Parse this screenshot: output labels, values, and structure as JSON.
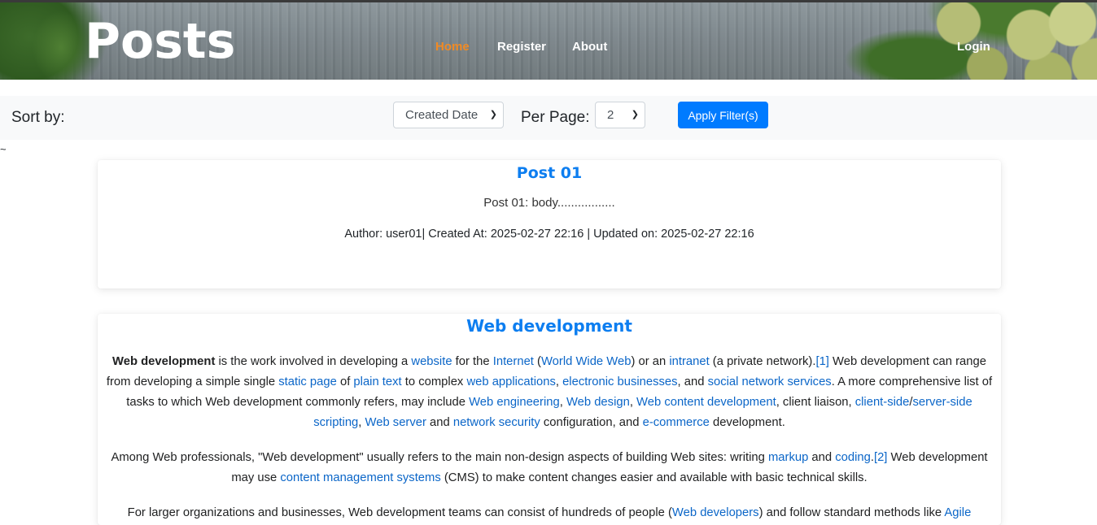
{
  "header": {
    "brand": "Posts",
    "nav": {
      "home": "Home",
      "register": "Register",
      "about": "About",
      "login": "Login"
    },
    "active_color": "#f08a24"
  },
  "filters": {
    "sort_label": "Sort by:",
    "sort_selected": "Created Date",
    "per_page_label": "Per Page:",
    "per_page_selected": "2",
    "apply_label": "Apply Filter(s)",
    "accent": "#007bff"
  },
  "stray_char": "~",
  "posts": [
    {
      "title": "Post 01",
      "body": "Post 01: body.................",
      "meta": "Author: user01| Created At: 2025-02-27 22:16 | Updated on: 2025-02-27 22:16"
    },
    {
      "title": "Web development",
      "p1": {
        "a": "Web development",
        "b": " is the work involved in developing a ",
        "c": "website",
        "d": " for the ",
        "e": "Internet",
        "f": " (",
        "g": "World Wide Web",
        "h": ") or an ",
        "i": "intranet",
        "j": " (a private network).",
        "k": "[1]",
        "l": " Web development can range from developing a simple single ",
        "m": "static page",
        "n": " of ",
        "o": "plain text",
        "p": " to complex ",
        "q": "web applications",
        "r": ", ",
        "s": "electronic businesses",
        "t": ", and ",
        "u": "social network services",
        "v": ". A more comprehensive list of tasks to which Web development commonly refers, may include ",
        "w": "Web engineering",
        "x": ", ",
        "y": "Web design",
        "z": ", ",
        "aa": "Web content development",
        "ab": ", client liaison, ",
        "ac": "client-side",
        "ad": "/",
        "ae": "server-side scripting",
        "af": ", ",
        "ag": "Web server",
        "ah": " and ",
        "ai": "network security",
        "aj": " configuration, and ",
        "ak": "e-commerce",
        "al": " development."
      },
      "p2": {
        "a": "Among Web professionals, \"Web development\" usually refers to the main non-design aspects of building Web sites: writing ",
        "b": "markup",
        "c": " and ",
        "d": "coding",
        "e": ".",
        "f": "[2]",
        "g": " Web development may use ",
        "h": "content management systems",
        "i": " (CMS) to make content changes easier and available with basic technical skills."
      },
      "p3": {
        "a": "For larger organizations and businesses, Web development teams can consist of hundreds of people (",
        "b": "Web developers",
        "c": ") and follow standard methods like ",
        "d": "Agile"
      }
    }
  ]
}
